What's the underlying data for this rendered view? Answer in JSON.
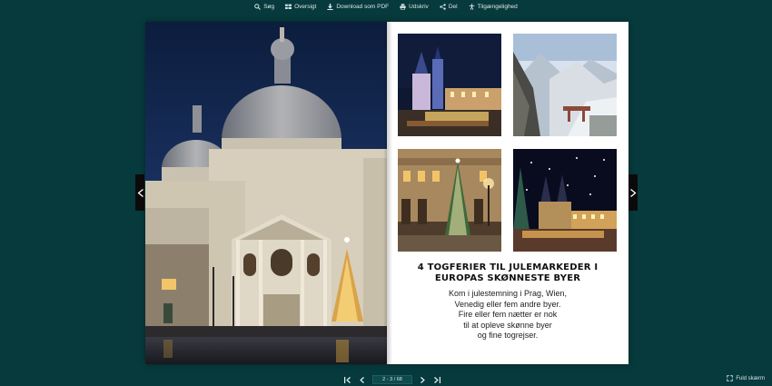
{
  "toolbar": {
    "items": [
      {
        "label": "Søg",
        "icon": "search-icon"
      },
      {
        "label": "Oversigt",
        "icon": "grid-icon"
      },
      {
        "label": "Download som PDF",
        "icon": "download-icon"
      },
      {
        "label": "Udskriv",
        "icon": "printer-icon"
      },
      {
        "label": "Del",
        "icon": "share-icon"
      },
      {
        "label": "Tilgængelighed",
        "icon": "accessibility-icon"
      }
    ]
  },
  "article": {
    "headline_line1": "4 TOGFERIER TIL JULEMARKEDER I",
    "headline_line2": "EUROPAS SKØNNESTE BYER",
    "body_lines": [
      "Kom i julestemning i Prag, Wien,",
      "Venedig eller fem andre byer.",
      "Fire eller fem nætter er nok",
      "til at opleve skønne  byer",
      "og fine togrejser."
    ]
  },
  "pager": {
    "page_indicator": "2 - 3 / 68"
  },
  "fullscreen": {
    "label": "Fuld skærm"
  },
  "colors": {
    "background": "#073a3c",
    "page": "#ffffff",
    "headline": "#111111"
  }
}
